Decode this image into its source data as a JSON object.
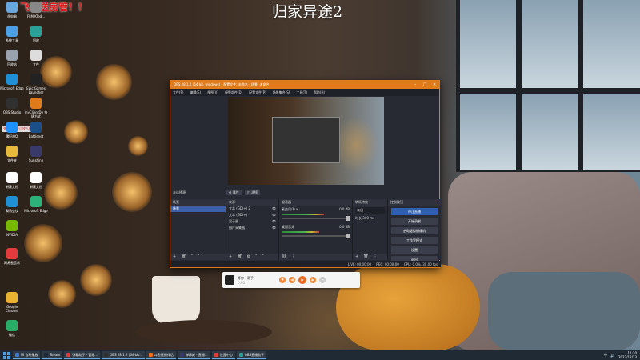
{
  "overlay": {
    "title": "归家异途2",
    "promo": "飞机送房管！！",
    "floating_text": "弹幕：一个小皮人偏爱"
  },
  "desktop_icons": [
    {
      "label": "此电脑",
      "icon": "computer-icon",
      "color": "#6aa8e0"
    },
    {
      "label": "FLMIKTed...",
      "icon": "file-icon",
      "color": "#888888"
    },
    {
      "label": "系统工具",
      "icon": "tools-icon",
      "color": "#4ea0e6"
    },
    {
      "label": "回收",
      "icon": "app-icon",
      "color": "#2aa198"
    },
    {
      "label": "回收站",
      "icon": "recycle-bin-icon",
      "color": "#9aa3ad"
    },
    {
      "label": "文件",
      "icon": "file-icon",
      "color": "#dddddd"
    },
    {
      "label": "Microsoft Edge",
      "icon": "edge-icon",
      "color": "#1f8fd6"
    },
    {
      "label": "Epic Games Launcher",
      "icon": "epic-icon",
      "color": "#222222"
    },
    {
      "label": "OBS Studio",
      "icon": "obs-icon",
      "color": "#303030"
    },
    {
      "label": "myClientDe 快捷方式",
      "icon": "app-icon",
      "color": "#e07b1b"
    },
    {
      "label": "腾讯QQ",
      "icon": "qq-icon",
      "color": "#1e90ff"
    },
    {
      "label": "Battlenet",
      "icon": "battlenet-icon",
      "color": "#1b4f8a"
    },
    {
      "label": "文件夹",
      "icon": "folder-icon",
      "color": "#e8b93a"
    },
    {
      "label": "Sunshine",
      "icon": "sun-icon",
      "color": "#3a3a6a"
    },
    {
      "label": "新建文档",
      "icon": "doc-icon",
      "color": "#ffffff"
    },
    {
      "label": "新建文档",
      "icon": "doc-icon",
      "color": "#ffffff"
    },
    {
      "label": "腾讯会议",
      "icon": "meeting-icon",
      "color": "#1f8fd6"
    },
    {
      "label": "Microsoft Edge",
      "icon": "edge-icon",
      "color": "#2db37a"
    },
    {
      "label": "NVIDIA",
      "icon": "nvidia-icon",
      "color": "#76b900"
    },
    {
      "label": "网易云音乐",
      "icon": "music-icon",
      "color": "#e23b3b"
    },
    {
      "label": "Google Chrome",
      "icon": "chrome-icon",
      "color": "#e9b230"
    },
    {
      "label": "微信",
      "icon": "wechat-icon",
      "color": "#2aae67"
    }
  ],
  "obs": {
    "title": "OBS 28.1.2 (64-bit, windows) - 配置文件: 未命名 - 场景: 未命名",
    "menu": [
      "文件(F)",
      "编辑(E)",
      "视图(V)",
      "停靠部件(D)",
      "配置文件(P)",
      "场景集合(S)",
      "工具(T)",
      "帮助(H)"
    ],
    "scene_tab_label": "未选择源",
    "tab_props": "属性",
    "tab_filters": "滤镜",
    "docks": {
      "scenes": {
        "title": "场景",
        "items": [
          "场景"
        ]
      },
      "sources": {
        "title": "来源",
        "items": [
          "文本 (GDI+) 2",
          "文本 (GDI+)",
          "显示器",
          "图片采集器"
        ]
      },
      "mixer": {
        "title": "混音器",
        "tracks": [
          {
            "name": "麦克风/Aux",
            "db": "0.0 dB",
            "level": 0.62
          },
          {
            "name": "桌面音频",
            "db": "0.0 dB",
            "level": 0.55
          }
        ]
      },
      "transitions": {
        "title": "转场特效",
        "type": "淡出",
        "duration_label": "时长",
        "duration": "300 ms"
      },
      "controls": {
        "title": "控制按钮",
        "buttons": [
          "停止直播",
          "开始录制",
          "启动虚拟摄像机",
          "工作室模式",
          "设置",
          "退出"
        ]
      }
    },
    "status": {
      "live": "LIVE: 00:00:00",
      "rec": "REC: 00:00:00",
      "cpu": "CPU: 0.0%, 30.00 fps"
    }
  },
  "player": {
    "song": "等你 - 歌手",
    "sub": "0:00"
  },
  "taskbar": {
    "items": [
      {
        "label": "UI 自动播放",
        "color": "#3a7bd5"
      },
      {
        "label": "Steam",
        "color": "#1b2838"
      },
      {
        "label": "弹幕助手 - 管理...",
        "color": "#e23b3b"
      },
      {
        "label": "OBS 28.1.2 (64-bit...",
        "color": "#303030"
      },
      {
        "label": "斗鱼直播伴侣",
        "color": "#f36b1f"
      },
      {
        "label": "弹幕姬 - 直播...",
        "color": "#3a3a6a"
      },
      {
        "label": "设置中心",
        "color": "#e23b3b"
      },
      {
        "label": "OBS直播助手",
        "color": "#2aa198"
      }
    ],
    "time": "11:30",
    "date": "2022/12/23"
  }
}
